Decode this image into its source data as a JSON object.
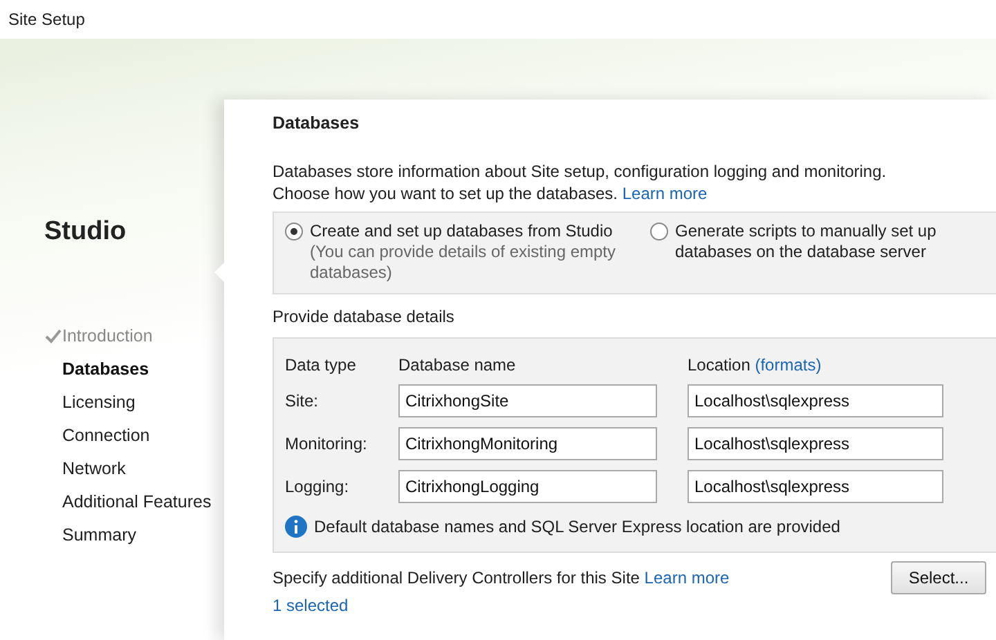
{
  "window": {
    "title": "Site Setup"
  },
  "sidebar": {
    "product": "Studio",
    "items": [
      {
        "label": "Introduction",
        "completed": true,
        "selected": false
      },
      {
        "label": "Databases",
        "completed": false,
        "selected": true
      },
      {
        "label": "Licensing",
        "completed": false,
        "selected": false
      },
      {
        "label": "Connection",
        "completed": false,
        "selected": false
      },
      {
        "label": "Network",
        "completed": false,
        "selected": false
      },
      {
        "label": "Additional Features",
        "completed": false,
        "selected": false
      },
      {
        "label": "Summary",
        "completed": false,
        "selected": false
      }
    ]
  },
  "page": {
    "heading": "Databases",
    "description": "Databases store information about Site setup, configuration logging and monitoring. Choose how you want to set up the databases.",
    "description_link": "Learn more",
    "options": [
      {
        "label": "Create and set up databases from Studio",
        "note": "(You can provide details of existing empty databases)",
        "selected": true
      },
      {
        "label": "Generate scripts to manually set up databases on the database server",
        "selected": false
      }
    ],
    "details_label": "Provide database details",
    "columns": {
      "data_type": "Data type",
      "database_name": "Database name",
      "location": "Location",
      "location_link": "(formats)"
    },
    "rows": [
      {
        "type": "Site:",
        "name": "CitrixhongSite",
        "location": "Localhost\\sqlexpress"
      },
      {
        "type": "Monitoring:",
        "name": "CitrixhongMonitoring",
        "location": "Localhost\\sqlexpress"
      },
      {
        "type": "Logging:",
        "name": "CitrixhongLogging",
        "location": "Localhost\\sqlexpress"
      }
    ],
    "info": "Default database names and SQL Server Express location are provided",
    "controllers_text": "Specify additional Delivery Controllers for this Site",
    "controllers_link": "Learn more",
    "select_button": "Select...",
    "selected_count": "1 selected"
  }
}
